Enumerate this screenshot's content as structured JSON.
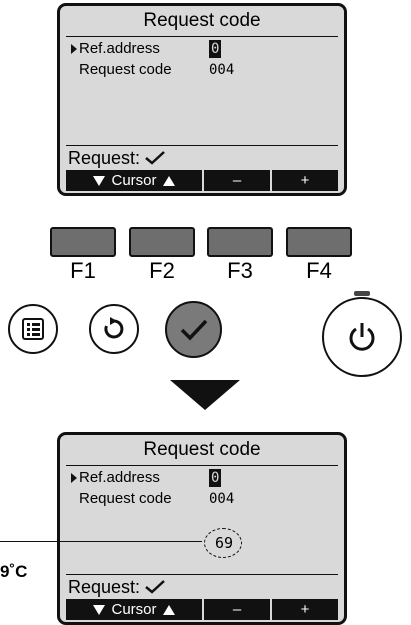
{
  "screen_top": {
    "title": "Request code",
    "rows": [
      {
        "label": "Ref.address",
        "value": "0",
        "selected": true
      },
      {
        "label": "Request code",
        "value": "004",
        "selected": false
      }
    ],
    "request_label": "Request:",
    "fbar": {
      "cursor_label": "Cursor",
      "minus": "–",
      "plus": "+"
    }
  },
  "function_keys": [
    "F1",
    "F2",
    "F3",
    "F4"
  ],
  "buttons": {
    "menu": "menu-icon",
    "return": "return-icon",
    "confirm": "check-icon",
    "power": "power-icon"
  },
  "screen_bottom": {
    "title": "Request code",
    "rows": [
      {
        "label": "Ref.address",
        "value": "0",
        "selected": true
      },
      {
        "label": "Request code",
        "value": "004",
        "selected": false
      }
    ],
    "result_code": "69",
    "callout_label": "9˚C",
    "request_label": "Request:",
    "fbar": {
      "cursor_label": "Cursor",
      "minus": "–",
      "plus": "+"
    }
  },
  "colors": {
    "lcd_bg": "#d9d9d9",
    "key_gray": "#6e6e6e",
    "confirm_gray": "#7a7a7a"
  }
}
